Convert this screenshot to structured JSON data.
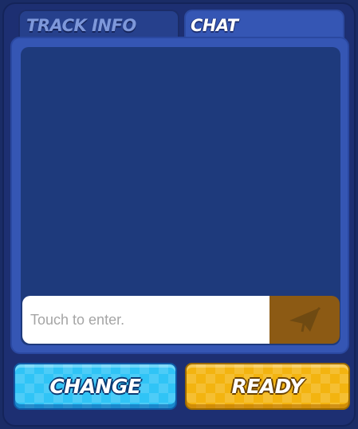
{
  "tabs": {
    "track_info": "TRACK INFO",
    "chat": "CHAT",
    "active": "chat"
  },
  "chat": {
    "input_placeholder": "Touch to enter.",
    "send_icon": "paper-plane-icon"
  },
  "buttons": {
    "change": "CHANGE",
    "ready": "READY"
  },
  "colors": {
    "panel": "#3556b4",
    "chat_area": "#1e3a7c",
    "change_button": "#30c4f6",
    "ready_button": "#f3b410",
    "send_button": "#8c5a14"
  }
}
